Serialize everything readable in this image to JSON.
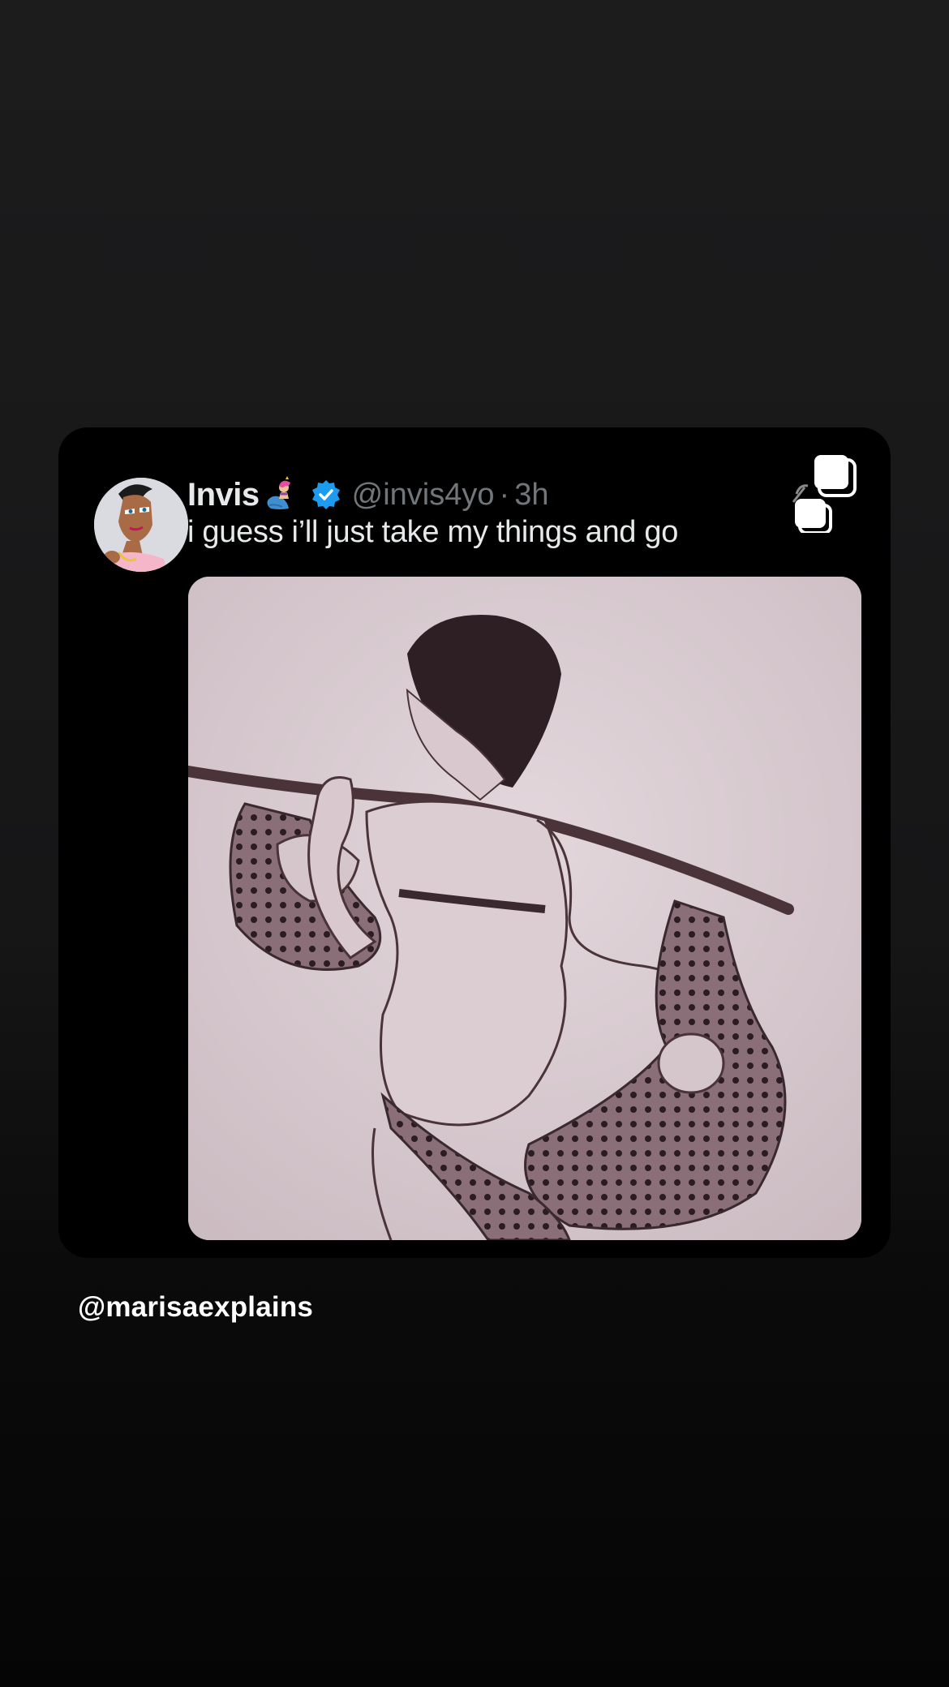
{
  "tweet": {
    "display_name": "Invis",
    "name_emoji": "mermaid-emoji",
    "verified": true,
    "handle": "@invis4yo",
    "separator": "·",
    "time": "3h",
    "text": "i guess i’ll just take my things and go"
  },
  "watermark": "@marisaexplains",
  "colors": {
    "page_background": "#1c1c1d",
    "card_background": "#000000",
    "primary_text": "#e7e9ea",
    "secondary_text": "#71767b",
    "verified_blue": "#1d9bf0"
  },
  "icons": {
    "copy": "copy-icon",
    "verified": "verified-badge-icon"
  }
}
